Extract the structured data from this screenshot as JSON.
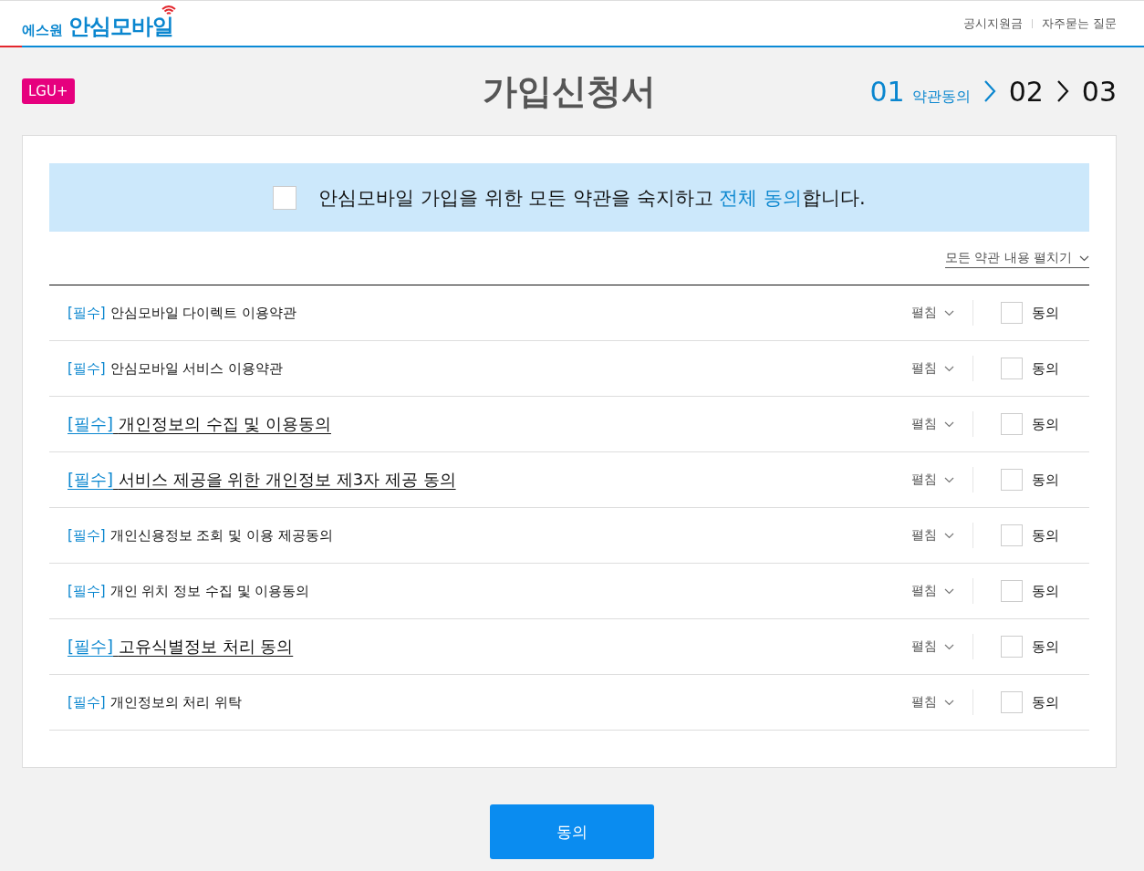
{
  "header": {
    "logo_small": "에스원",
    "logo_main": "안심모바일",
    "links": [
      "공시지원금",
      "자주묻는 질문"
    ]
  },
  "carrier_badge": "LGU+",
  "page_title": "가입신청서",
  "steps": [
    {
      "number": "01",
      "label": "약관동의",
      "selected": true
    },
    {
      "number": "02",
      "selected": false
    },
    {
      "number": "03",
      "selected": false
    }
  ],
  "agree_all": {
    "checked": false,
    "text": "안심모바일 가입을 위한 모든 약관을 숙지하고 **전체 동의**합니다."
  },
  "expand_all": "모든 약관 내용 펼치기",
  "terms": [
    {
      "tag": "[필수]",
      "title": "안심모바일 다이렉트 이용약관",
      "kind": "normal",
      "expand": "펼침",
      "agree": "동의",
      "checked": false
    },
    {
      "tag": "[필수]",
      "title": "안심모바일 서비스 이용약관",
      "kind": "normal",
      "expand": "펼침",
      "agree": "동의",
      "checked": false
    },
    {
      "tag": "[필수]",
      "title": "개인정보의 수집 및 이용동의",
      "kind": "emphasized",
      "expand": "펼침",
      "agree": "동의",
      "checked": false
    },
    {
      "tag": "[필수]",
      "title": "서비스 제공을 위한 개인정보 제3자 제공 동의",
      "kind": "emphasized",
      "expand": "펼침",
      "agree": "동의",
      "checked": false
    },
    {
      "tag": "[필수]",
      "title": "개인신용정보 조회 및 이용 제공동의",
      "kind": "normal",
      "expand": "펼침",
      "agree": "동의",
      "checked": false
    },
    {
      "tag": "[필수]",
      "title": "개인 위치 정보 수집 및 이용동의",
      "kind": "normal",
      "expand": "펼침",
      "agree": "동의",
      "checked": false
    },
    {
      "tag": "[필수]",
      "title": "고유식별정보 처리 동의",
      "kind": "emphasized",
      "expand": "펼침",
      "agree": "동의",
      "checked": false
    },
    {
      "tag": "[필수]",
      "title": "개인정보의 처리 위탁",
      "kind": "normal",
      "expand": "펼침",
      "agree": "동의",
      "checked": false
    }
  ],
  "submit_button": "동의"
}
